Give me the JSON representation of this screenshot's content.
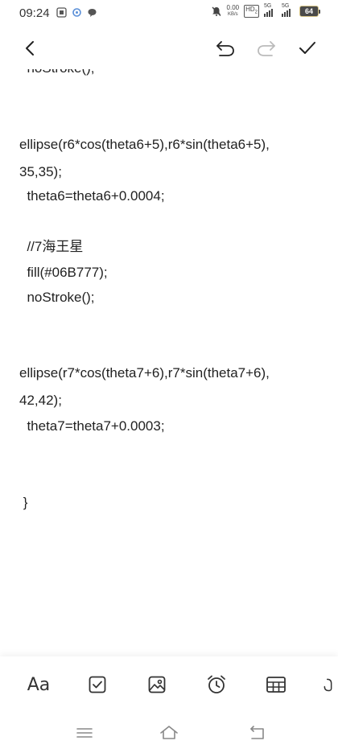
{
  "status_bar": {
    "time": "09:24",
    "net_speed_value": "0.00",
    "net_speed_unit": "KB/s",
    "hd_label": "HD",
    "hd_sub": "2",
    "sim1_label": "5G",
    "sim2_label": "5G",
    "battery_level": "64",
    "icons": [
      "app-notification-icon",
      "app-notification-icon",
      "chat-bubble-icon",
      "mute-bell-icon",
      "signal-icon",
      "battery-icon"
    ]
  },
  "toolbar": {
    "icons": [
      "back-arrow-icon",
      "undo-icon",
      "redo-icon",
      "checkmark-icon"
    ]
  },
  "editor": {
    "lines": [
      "  noStroke();",
      "ellipse(r6*cos(theta6+5),r6*sin(theta6+5),",
      "35,35);",
      "  theta6=theta6+0.0004;",
      "  //7海王星",
      "  fill(#06B777);",
      "  noStroke();",
      "ellipse(r7*cos(theta7+6),r7*sin(theta7+6),",
      "42,42);",
      "  theta7=theta7+0.0003;",
      " }"
    ]
  },
  "format_bar": {
    "text_style_label": "Aa",
    "icons": [
      "text-style-icon",
      "checkbox-icon",
      "image-icon",
      "alarm-clock-icon",
      "table-icon",
      "pen-icon"
    ]
  },
  "nav_bar": {
    "icons": [
      "menu-icon",
      "home-icon",
      "back-icon"
    ]
  },
  "colors": {
    "background": "#ffffff",
    "text": "#222222",
    "disabled_icon": "#bbbbbb"
  }
}
